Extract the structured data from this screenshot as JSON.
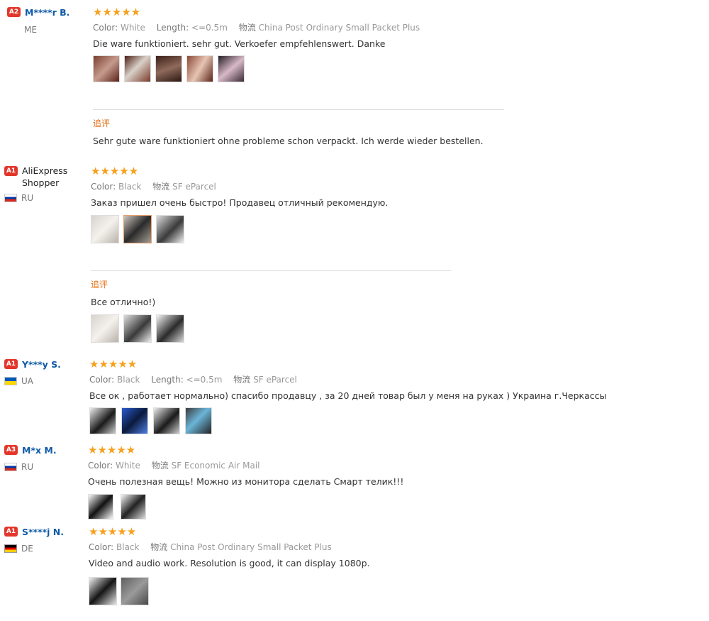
{
  "reviews": [
    {
      "badge": "A2",
      "name": "M****r B.",
      "country": "ME",
      "flag": "",
      "stars": "★★★★★",
      "meta": [
        {
          "label": "Color:",
          "value": "White"
        },
        {
          "label": "Length:",
          "value": "<=0.5m"
        },
        {
          "label": "物流",
          "value": "China Post Ordinary Small Packet Plus"
        }
      ],
      "text": "Die ware funktioniert. sehr gut. Verkoefer empfehlenswert. Danke",
      "images": 5,
      "followup": {
        "label": "追评",
        "text": "Sehr gute ware funktioniert ohne probleme schon verpackt. Ich werde wieder bestellen."
      }
    },
    {
      "badge": "A1",
      "name": "AliExpress Shopper",
      "country": "RU",
      "flag": "ru",
      "stars": "★★★★★",
      "meta": [
        {
          "label": "Color:",
          "value": "Black"
        },
        {
          "label": "物流",
          "value": "SF eParcel"
        }
      ],
      "text": "Заказ пришел очень быстро! Продавец отличный рекомендую.",
      "images": 3,
      "followup": {
        "label": "追评",
        "text": "Все отлично!)",
        "images": 3
      }
    },
    {
      "badge": "A1",
      "name": "Y***y S.",
      "country": "UA",
      "flag": "ua",
      "stars": "★★★★★",
      "meta": [
        {
          "label": "Color:",
          "value": "Black"
        },
        {
          "label": "Length:",
          "value": "<=0.5m"
        },
        {
          "label": "物流",
          "value": "SF eParcel"
        }
      ],
      "text": "Все ок , работает нормально) спасибо продавцу , за 20 дней товар был у меня на руках ) Украина г.Черкассы",
      "images": 4
    },
    {
      "badge": "A3",
      "name": "M*x M.",
      "country": "RU",
      "flag": "ru",
      "stars": "★★★★★",
      "meta": [
        {
          "label": "Color:",
          "value": "White"
        },
        {
          "label": "物流",
          "value": "SF Economic Air Mail"
        }
      ],
      "text": "Очень полезная вещь! Можно из монитора сделать Смарт телик!!!",
      "images": 2
    },
    {
      "badge": "A1",
      "name": "S****j N.",
      "country": "DE",
      "flag": "de",
      "stars": "★★★★★",
      "meta": [
        {
          "label": "Color:",
          "value": "Black"
        },
        {
          "label": "物流",
          "value": "China Post Ordinary Small Packet Plus"
        }
      ],
      "text": "Video and audio work. Resolution is good, it can display 1080p.",
      "images": 2
    }
  ]
}
